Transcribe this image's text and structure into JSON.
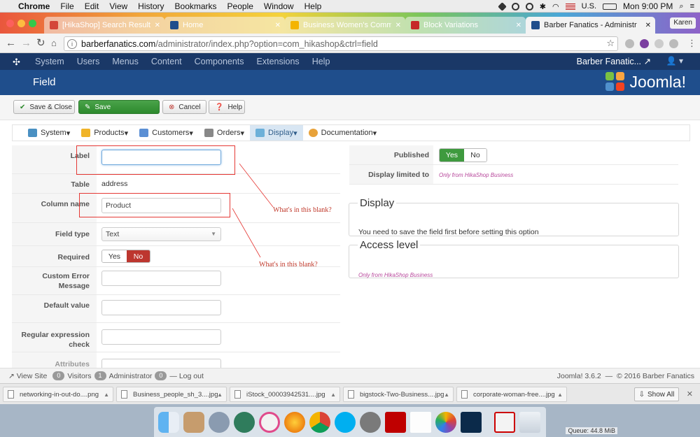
{
  "menubar": {
    "app": "Chrome",
    "items": [
      "File",
      "Edit",
      "View",
      "History",
      "Bookmarks",
      "People",
      "Window",
      "Help"
    ],
    "input_source": "U.S.",
    "clock": "Mon 9:00 PM"
  },
  "tabs": [
    {
      "title": "[HikaShop] Search Result is",
      "icon_color": "#d44638"
    },
    {
      "title": "Home",
      "icon_color": "#1f4e8c"
    },
    {
      "title": "Business Women's Commun",
      "icon_color": "#f4b400"
    },
    {
      "title": "Block Variations",
      "icon_color": "#c62828"
    },
    {
      "title": "Barber Fanatics - Administr",
      "icon_color": "#1f4e8c"
    }
  ],
  "profile_name": "Karen",
  "address": {
    "domain": "barberfanatics.com",
    "path": "/administrator/index.php?option=com_hikashop&ctrl=field"
  },
  "joomla_bar": {
    "items": [
      "System",
      "Users",
      "Menus",
      "Content",
      "Components",
      "Extensions",
      "Help"
    ],
    "site_name": "Barber Fanatic...",
    "site_link_icon": "external-link-icon",
    "user_icon": "user-icon"
  },
  "page": {
    "title": "Field",
    "brand": "Joomla!"
  },
  "toolbar": {
    "save_close": "Save & Close",
    "save": "Save",
    "cancel": "Cancel",
    "help": "Help"
  },
  "hikamenu": [
    {
      "label": "System",
      "icon_color": "#4a90c2"
    },
    {
      "label": "Products",
      "icon_color": "#f0b429"
    },
    {
      "label": "Customers",
      "icon_color": "#5b8fd4"
    },
    {
      "label": "Orders",
      "icon_color": "#777777"
    },
    {
      "label": "Display",
      "icon_color": "#6cb0d9"
    },
    {
      "label": "Documentation",
      "icon_color": "#e8a23a"
    }
  ],
  "form": {
    "label": {
      "label": "Label",
      "value": ""
    },
    "table": {
      "label": "Table",
      "value": "address"
    },
    "column_name": {
      "label": "Column name",
      "value": "Product"
    },
    "field_type": {
      "label": "Field type",
      "value": "Text"
    },
    "required": {
      "label": "Required",
      "yes": "Yes",
      "no": "No"
    },
    "custom_error": {
      "label_line1": "Custom Error",
      "label_line2": "Message",
      "value": ""
    },
    "default_value": {
      "label": "Default value",
      "value": ""
    },
    "regex": {
      "label_line1": "Regular expression",
      "label_line2": "check",
      "value": ""
    },
    "attributes": {
      "label": "Attributes"
    }
  },
  "annotations": {
    "note1": "What's in this blank?",
    "note2": "What's in this blank?"
  },
  "right": {
    "published": {
      "label": "Published",
      "yes": "Yes",
      "no": "No"
    },
    "display_limited": {
      "label": "Display limited to",
      "value": "Only from HikaShop Business"
    },
    "display_section": {
      "legend": "Display",
      "text": "You need to save the field first before setting this option"
    },
    "access_section": {
      "legend": "Access level",
      "text": "Only from HikaShop Business"
    }
  },
  "status": {
    "view_site": "View Site",
    "visitors_count": "0",
    "visitors": "Visitors",
    "admin_count": "1",
    "admin": "Administrator",
    "logout_count": "0",
    "logout": "Log out",
    "version": "Joomla! 3.6.2",
    "copyright": "© 2016 Barber Fanatics"
  },
  "downloads": {
    "files": [
      "networking-in-out-do....png",
      "Business_people_sh_3....jpg",
      "iStock_00003942531....jpg",
      "bigstock-Two-Business....jpg",
      "corporate-woman-free....jpg"
    ],
    "show_all": "Show All"
  },
  "dock": {
    "queue": "Queue: 44.8 MiB",
    "apps": [
      "finder-icon",
      "contacts-icon",
      "launchpad-icon",
      "time-machine-icon",
      "itunes-icon",
      "firefox-icon",
      "chrome-icon",
      "skype-icon",
      "system-preferences-icon",
      "filezilla-icon",
      "textedit-icon",
      "photos-icon",
      "photoshop-icon",
      "acrobat-icon",
      "trash-icon"
    ]
  }
}
